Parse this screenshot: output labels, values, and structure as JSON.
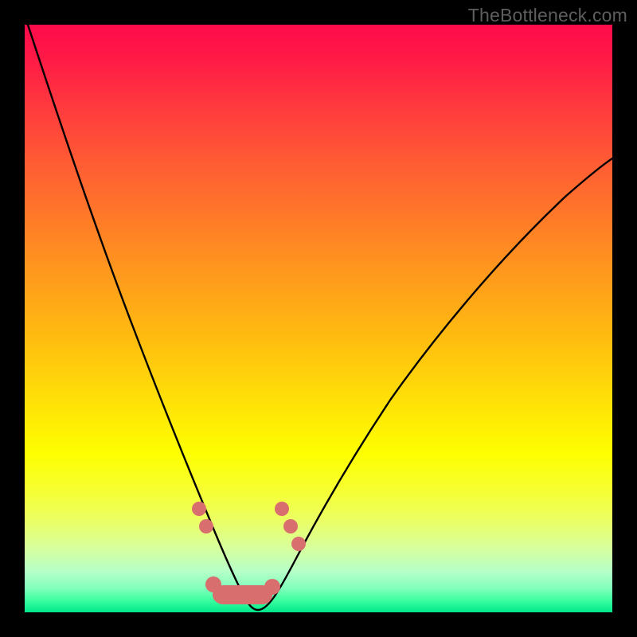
{
  "watermark": "TheBottleneck.com",
  "colors": {
    "background": "#000000",
    "gradient_top": "#ff0a4a",
    "gradient_bottom": "#00e68a",
    "curve": "#000000",
    "marker": "#d96e6e"
  },
  "chart_data": {
    "type": "line",
    "title": "",
    "xlabel": "",
    "ylabel": "",
    "xlim": [
      0,
      100
    ],
    "ylim": [
      0,
      100
    ],
    "annotations": [
      "TheBottleneck.com"
    ],
    "x": [
      0,
      4,
      8,
      12,
      16,
      20,
      24,
      27,
      29,
      31,
      33,
      35,
      37,
      40,
      44,
      48,
      52,
      56,
      60,
      66,
      72,
      78,
      84,
      90,
      96,
      100
    ],
    "y": [
      100,
      89,
      78,
      67,
      56,
      45,
      34,
      24,
      17,
      11,
      6,
      3,
      1,
      0,
      2,
      6,
      12,
      19,
      26,
      35,
      44,
      52,
      60,
      66,
      72,
      76
    ],
    "minimum_x": 38,
    "markers": [
      {
        "kind": "dot",
        "x": 29.5,
        "y": 18
      },
      {
        "kind": "dot",
        "x": 30.5,
        "y": 15
      },
      {
        "kind": "dot",
        "x": 43.0,
        "y": 18
      },
      {
        "kind": "dot",
        "x": 44.5,
        "y": 15
      },
      {
        "kind": "dot",
        "x": 45.5,
        "y": 12
      },
      {
        "kind": "pill",
        "x0": 32.5,
        "x1": 41.0,
        "y": 2.5
      }
    ]
  }
}
